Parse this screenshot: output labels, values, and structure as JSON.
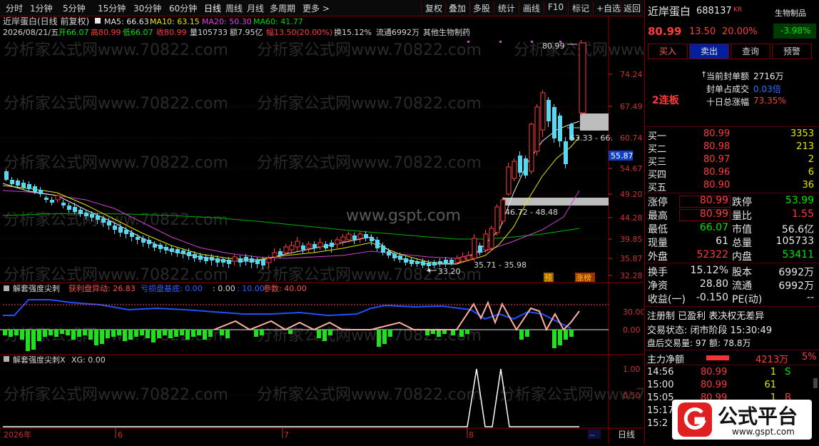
{
  "toolbar": {
    "left_items": [
      "分时",
      "1分钟",
      "5分钟",
      "15分钟",
      "30分钟",
      "60分钟",
      "日线",
      "周线",
      "月线",
      "多周期",
      "更多 >"
    ],
    "right_items": [
      "复权",
      "叠加",
      "多股",
      "统计",
      "画线",
      "F10",
      "标记",
      "+自选",
      "返回"
    ]
  },
  "stock": {
    "name": "近岸蛋白",
    "title_line": "近岸蛋白(日线 前复权)",
    "ma": {
      "ma5": "MA5: 66.63",
      "ma10": "MA10: 63.15",
      "ma20": "MA20: 50.30",
      "ma60": "MA60: 41.77"
    },
    "info_line": {
      "date": "2026/08/21/五",
      "open": "开66.07",
      "high": "高80.99",
      "low": "低66.07",
      "close": "收80.99",
      "vol": "量105733",
      "amt": "额7.95亿",
      "chg": "幅13.50(20.00%)",
      "turnover": "换15.12%",
      "float": "流通6992万",
      "industry": "其他生物制药"
    }
  },
  "main_chart": {
    "price_labels": [
      "74.24",
      "67.49",
      "60.74",
      "54.67",
      "49.20",
      "44.28",
      "39.85",
      "35.87",
      "32.28"
    ],
    "current_price_tag": "55.87",
    "annotations": {
      "top": "80.99",
      "box1": "63.33 - 66.",
      "box2": "46.72 - 48.48",
      "range1": "35.71 - 35.98",
      "low": "33.20"
    },
    "badges": {
      "yu": "预",
      "zhang": "涨榜"
    },
    "watermarks": [
      "分析家公式网www.70822.com",
      "www.gspt.com"
    ]
  },
  "indicator1": {
    "name": "解套强度尖刺",
    "items": [
      {
        "label": "获利盘异动: 26.83",
        "color": "#ff5050"
      },
      {
        "label": "亏损盘基底: 0.00",
        "color": "#3060ff"
      },
      {
        "label": ": 0.00",
        "color": "#d8d8d8"
      },
      {
        "label": ": 10.00",
        "color": "#3060ff"
      },
      {
        "label": "参数: 40.00",
        "color": "#ff5050"
      }
    ],
    "axis": [
      "30.00",
      "0.00"
    ]
  },
  "indicator2": {
    "name": "解套强度尖刺X",
    "item": "XG: 0.00",
    "axis": [
      "1.00",
      "0.50"
    ]
  },
  "time_axis": {
    "labels": [
      "2026年",
      "6",
      "7",
      "8"
    ],
    "period": "日线",
    "arrow": "--"
  },
  "panel": {
    "name": "近岸蛋白",
    "code": "688137",
    "suffix": "KR",
    "sector_tag": "生物制品",
    "sector_chg": "-3.98%",
    "price": "80.99",
    "chg": "13.50",
    "pct": "20.00%",
    "buttons": [
      "买入",
      "卖出",
      "查询",
      "预警"
    ],
    "limit_stats": [
      {
        "label": "当前封单额",
        "value": "2716万"
      },
      {
        "label": "封单占成交",
        "value": "0.03倍"
      },
      {
        "label": "十日总涨幅",
        "value": "73.35%"
      }
    ],
    "board_tag": "2连板",
    "bids": [
      {
        "label": "买一",
        "price": "80.99",
        "vol": "3353"
      },
      {
        "label": "买二",
        "price": "80.98",
        "vol": "213"
      },
      {
        "label": "买三",
        "price": "80.97",
        "vol": "2"
      },
      {
        "label": "买四",
        "price": "80.96",
        "vol": "6"
      },
      {
        "label": "买五",
        "price": "80.90",
        "vol": "36"
      }
    ],
    "quote_rows": [
      {
        "l1": "涨停",
        "v1": "80.99",
        "c1": "red",
        "l2": "跌停",
        "v2": "53.99",
        "c2": "grn"
      },
      {
        "l1": "最高",
        "v1": "80.99",
        "c1": "red",
        "l2": "量比",
        "v2": "1.55",
        "c2": "red"
      },
      {
        "l1": "最低",
        "v1": "66.07",
        "c1": "grn",
        "l2": "市值",
        "v2": "56.6亿",
        "c2": "wht"
      },
      {
        "l1": "现量",
        "v1": "61",
        "c1": "wht",
        "l2": "总量",
        "v2": "105733",
        "c2": "wht"
      },
      {
        "l1": "外盘",
        "v1": "52322",
        "c1": "red",
        "l2": "内盘",
        "v2": "53411",
        "c2": "grn"
      }
    ],
    "fund_rows": [
      {
        "l1": "换手",
        "v1": "15.12%",
        "l2": "股本",
        "v2": "6992万"
      },
      {
        "l1": "净资",
        "v1": "28.80",
        "l2": "流通",
        "v2": "6992万"
      },
      {
        "l1": "收益(一)",
        "v1": "-0.150",
        "l2": "PE(动)",
        "v2": "--"
      }
    ],
    "tags_line": "注册制 已盈利 表决权无差异",
    "trade_status": "交易状态: 闭市阶段 15:30:49",
    "after_hours": "盘后交易量: 97  额: 78.8万",
    "net_inflow_label": "主力净额",
    "net_inflow_value": "4213万",
    "net_inflow_pct": "5%",
    "ticks": [
      {
        "time": "14:56",
        "price": "80.99",
        "vol": "1",
        "side": "S"
      },
      {
        "time": "15:00",
        "price": "80.99",
        "vol": "61",
        "side": ""
      },
      {
        "time": "15:05",
        "price": "80.99",
        "vol": "1",
        "side": "B"
      },
      {
        "time": "15:17",
        "price": "",
        "vol": "",
        "side": ""
      },
      {
        "time": "15:2",
        "price": "",
        "vol": "",
        "side": ""
      }
    ]
  },
  "logo": {
    "text": "公式平台",
    "url": "www.gspt.com"
  }
}
